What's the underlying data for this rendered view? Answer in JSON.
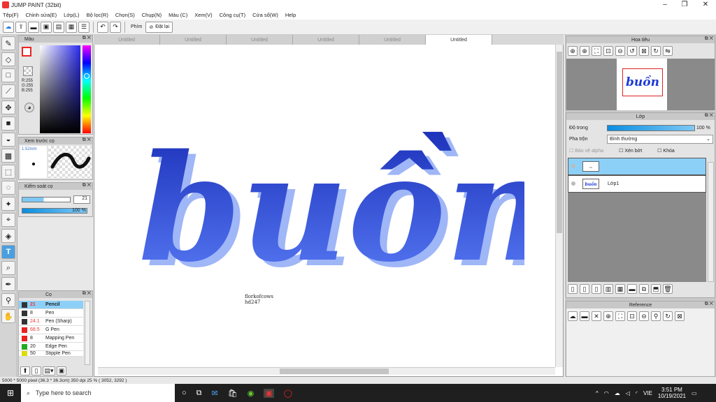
{
  "window": {
    "title": "JUMP PAINT (32bit)"
  },
  "menu": [
    "Tệp(F)",
    "Chỉnh sửa(E)",
    "Lớp(L)",
    "Bộ lọc(R)",
    "Chọn(S)",
    "Chụp(N)",
    "Màu (C)",
    "Xem(V)",
    "Công cụ(T)",
    "Cửa sổ(W)",
    "Help"
  ],
  "toolbar": {
    "phim_label": "Phím",
    "reset_label": "Đặt lại"
  },
  "tabs": [
    "Untitled",
    "Untitled",
    "Untitled",
    "Untitled",
    "Untitled",
    "Untitled"
  ],
  "color_panel": {
    "title": "Màu",
    "r": "R:255",
    "g": "G:255",
    "b": "B:255"
  },
  "preview_panel": {
    "title": "Xem trước cọ",
    "size": "1.52mm"
  },
  "brush_control": {
    "title": "Kiểm soát cọ",
    "size_value": "21",
    "opacity_label": "100 %"
  },
  "brush_panel": {
    "title": "Cọ",
    "items": [
      {
        "size": "21",
        "name": "Pencil",
        "color": "#333333"
      },
      {
        "size": "8",
        "name": "Pen",
        "color": "#333333"
      },
      {
        "size": "24.1",
        "name": "Pen (Sharp)",
        "color": "#333333"
      },
      {
        "size": "68.5",
        "name": "G Pen",
        "color": "#e82020"
      },
      {
        "size": "8",
        "name": "Mapping Pen",
        "color": "#e82020"
      },
      {
        "size": "20",
        "name": "Edge Pen",
        "color": "#22aa22"
      },
      {
        "size": "50",
        "name": "Stipple Pen",
        "color": "#dddd00"
      }
    ]
  },
  "canvas": {
    "artwork_text": "buồn",
    "signature_line1": "florkofcows",
    "signature_line2": "hd247"
  },
  "navigator": {
    "title": "Hoa tiêu"
  },
  "layers_panel": {
    "title": "Lớp",
    "opacity_label": "Độ trong",
    "opacity_value": "100 %",
    "blend_label": "Pha trộn",
    "blend_value": "Bình thường",
    "protect_alpha": "Bảo vệ alpha",
    "clipping": "Xén bớt",
    "lock": "Khóa",
    "layers": [
      {
        "name": ""
      },
      {
        "name": "Lớp1"
      }
    ]
  },
  "reference_panel": {
    "title": "Reference"
  },
  "status": "5000 * 5000 pixel  (36.3 * 36.3cm)  350 dpi  25 %  ( 3052, 3292 )",
  "taskbar": {
    "search_placeholder": "Type here to search",
    "lang": "VIE",
    "time": "3:51 PM",
    "date": "10/19/2021"
  },
  "colors": {
    "accent": "#1e3bd6",
    "accent_light": "#6e9cf5",
    "selected": "#8dd0f7"
  }
}
